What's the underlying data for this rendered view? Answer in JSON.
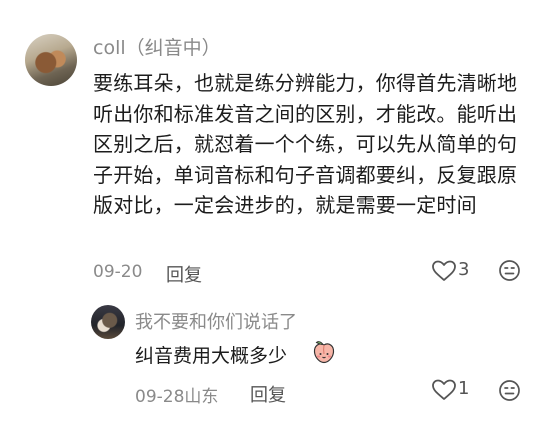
{
  "comment": {
    "username": "coll",
    "status": "纠音中",
    "text": "要练耳朵，也就是练分辨能力，你得首先清晰地听出你和标准发音之间的区别，才能改。能听出区别之后，就怼着一个个练，可以先从简单的句子开始，单词音标和句子音调都要纠，反复跟原版对比，一定会进步的，就是需要一定时间",
    "date": "09-20",
    "reply_label": "回复",
    "like_count": "3",
    "icons": {
      "like": "heart-icon",
      "emoji": "emoji-icon"
    }
  },
  "reply": {
    "username": "我不要和你们说话了",
    "text": "纠音费用大概多少",
    "emoji": "peach-emoji",
    "date": "09-28",
    "location": "山东",
    "reply_label": "回复",
    "like_count": "1"
  },
  "colors": {
    "meta": "#8a8a8a",
    "text": "#1c1c1c"
  }
}
